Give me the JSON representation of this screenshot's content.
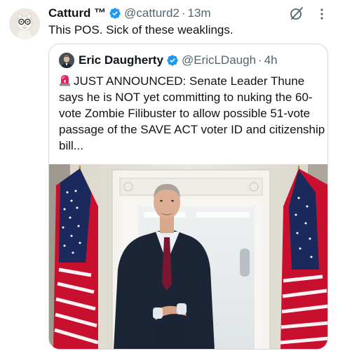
{
  "tweet": {
    "author_name": "Catturd ™",
    "author_handle": "@catturd2",
    "separator": "·",
    "time": "13m",
    "text": "This POS. Sick of these weaklings."
  },
  "quoted": {
    "author_name": "Eric Daugherty",
    "author_handle": "@EricLDaugh",
    "separator": "·",
    "time": "4h",
    "text": "JUST ANNOUNCED: Senate Leader Thune says he is NOT yet committing to nuking the 60-vote Zombie Filibuster to allow possible 51-vote passage of the SAVE ACT voter ID and citizenship bill..."
  },
  "colors": {
    "verified": "#1d9bf0",
    "secondary_text": "#536471",
    "border": "#cfd9de"
  },
  "icons": {
    "verified": "verified-badge-icon",
    "grok": "grok-icon",
    "more": "more-options-icon",
    "siren": "siren-emoji-icon"
  }
}
